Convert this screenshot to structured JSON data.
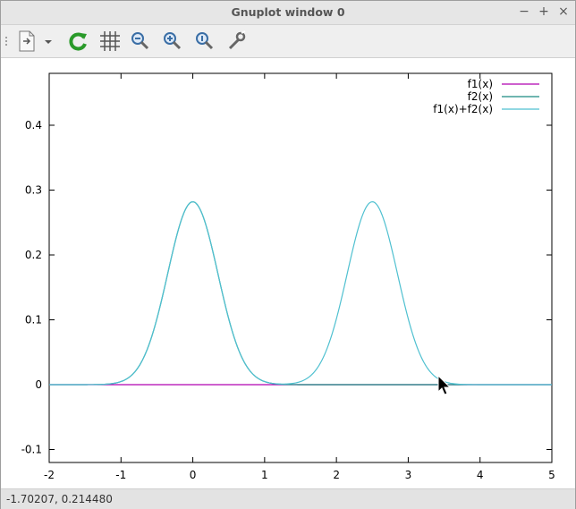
{
  "window": {
    "title": "Gnuplot window 0",
    "minimize": "−",
    "maximize": "+",
    "close": "×"
  },
  "toolbar": {
    "items": [
      {
        "name": "export",
        "icon": "document-export-icon"
      },
      {
        "name": "export-menu",
        "icon": "chevron-down-icon"
      },
      {
        "name": "replot",
        "icon": "refresh-icon"
      },
      {
        "name": "grid",
        "icon": "grid-icon"
      },
      {
        "name": "zoom-back",
        "icon": "zoom-out-icon"
      },
      {
        "name": "zoom-forward",
        "icon": "zoom-in-icon"
      },
      {
        "name": "autoscale",
        "icon": "zoom-reset-icon"
      },
      {
        "name": "settings",
        "icon": "wrench-icon"
      }
    ]
  },
  "status": {
    "coordinates": "-1.70207,  0.214480"
  },
  "chart_data": {
    "type": "line",
    "title": "",
    "xlabel": "",
    "ylabel": "",
    "xlim": [
      -2,
      5
    ],
    "ylim": [
      -0.12,
      0.48
    ],
    "xticks": [
      "-2",
      "-1",
      "0",
      "1",
      "2",
      "3",
      "4",
      "5"
    ],
    "yticks": [
      "-0.1",
      "0",
      "0.1",
      "0.2",
      "0.3",
      "0.4"
    ],
    "legend_position": "top-right",
    "grid": false,
    "series": [
      {
        "name": "f1(x)",
        "color": "#b000b0",
        "x": [
          -2,
          5
        ],
        "y": [
          0,
          0
        ]
      },
      {
        "name": "f2(x)",
        "color": "#1a8a80",
        "gaussian": {
          "amplitude": 0.282,
          "mean": 0.0,
          "sd": 0.35
        }
      },
      {
        "name": "f1(x)+f2(x)",
        "color": "#4fc0d0",
        "gaussian_sum": [
          {
            "amplitude": 0.282,
            "mean": 0.0,
            "sd": 0.35
          },
          {
            "amplitude": 0.282,
            "mean": 2.5,
            "sd": 0.35
          }
        ]
      }
    ]
  }
}
